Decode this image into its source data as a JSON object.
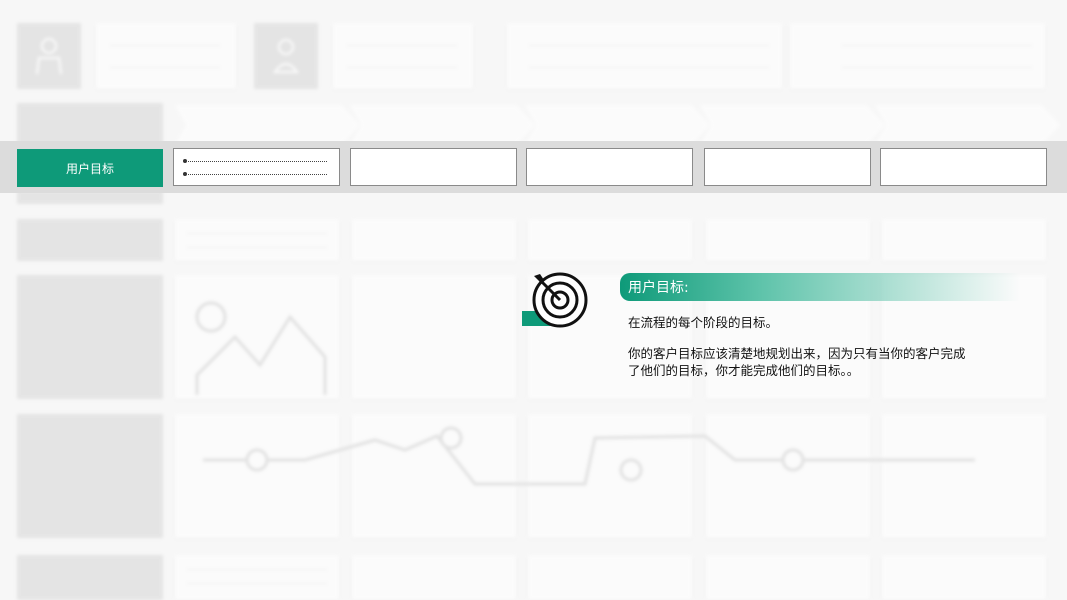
{
  "highlight": {
    "label": "用户目标"
  },
  "callout": {
    "title": "用户目标:",
    "line1": "在流程的每个阶段的目标。",
    "line2": "你的客户目标应该清楚地规划出来，因为只有当你的客户完成",
    "line3": "了他们的目标，你才能完成他们的目标。。"
  },
  "colors": {
    "accent": "#0e9a79",
    "band": "#dcdcdc",
    "placeholder": "#d6d6d6"
  },
  "icons": {
    "target": "target-arrow-icon",
    "person": "person-icon",
    "mountain": "image-placeholder-icon"
  }
}
